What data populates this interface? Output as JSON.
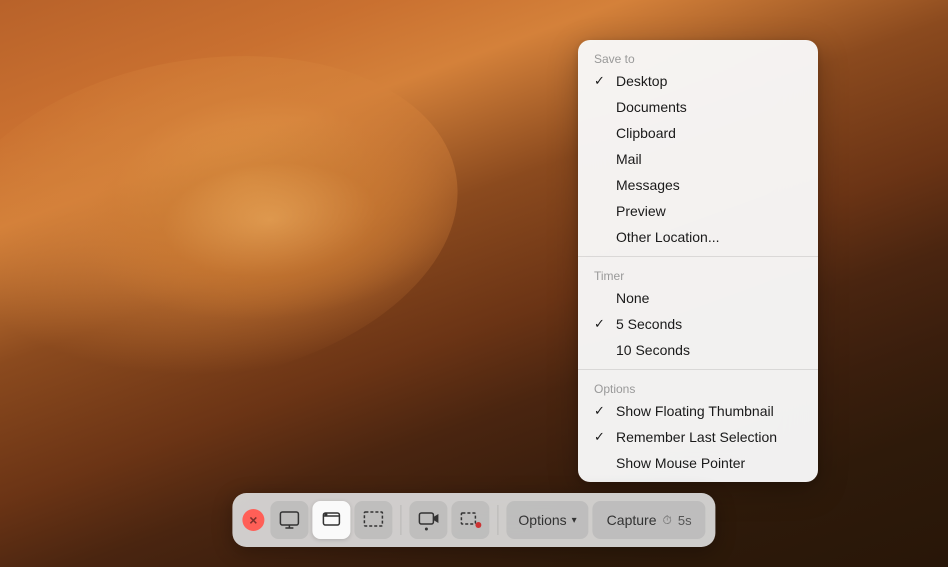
{
  "desktop": {
    "background": "macOS Mojave desert"
  },
  "dropdown": {
    "saveto_label": "Save to",
    "items_saveto": [
      {
        "id": "desktop",
        "label": "Desktop",
        "checked": true
      },
      {
        "id": "documents",
        "label": "Documents",
        "checked": false
      },
      {
        "id": "clipboard",
        "label": "Clipboard",
        "checked": false
      },
      {
        "id": "mail",
        "label": "Mail",
        "checked": false
      },
      {
        "id": "messages",
        "label": "Messages",
        "checked": false
      },
      {
        "id": "preview",
        "label": "Preview",
        "checked": false
      },
      {
        "id": "other",
        "label": "Other Location...",
        "checked": false
      }
    ],
    "timer_label": "Timer",
    "items_timer": [
      {
        "id": "none",
        "label": "None",
        "checked": false
      },
      {
        "id": "5s",
        "label": "5 Seconds",
        "checked": true
      },
      {
        "id": "10s",
        "label": "10 Seconds",
        "checked": false
      }
    ],
    "options_label": "Options",
    "items_options": [
      {
        "id": "float-thumb",
        "label": "Show Floating Thumbnail",
        "checked": true
      },
      {
        "id": "remember",
        "label": "Remember Last Selection",
        "checked": true
      },
      {
        "id": "mouse",
        "label": "Show Mouse Pointer",
        "checked": false
      }
    ]
  },
  "toolbar": {
    "close_label": "",
    "options_label": "Options",
    "options_chevron": "▾",
    "capture_label": "Capture",
    "capture_timer": "⏱ 5s",
    "capture_timer_icon": "⏱",
    "capture_timer_text": "5s"
  }
}
